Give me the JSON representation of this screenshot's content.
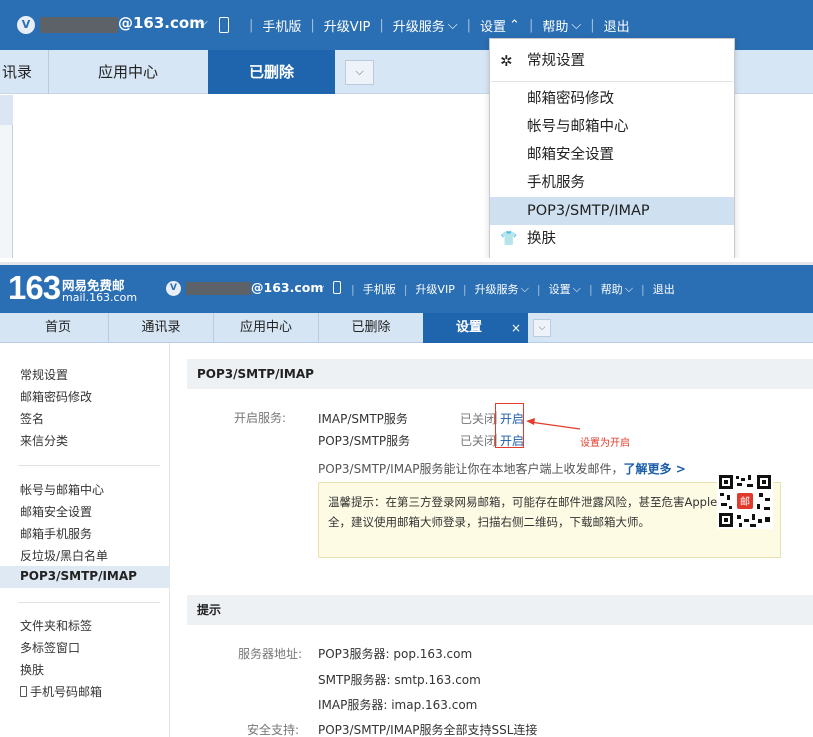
{
  "top": {
    "avatar": "V",
    "email_suffix": "@163.com",
    "nav": [
      "手机版",
      "升级VIP",
      "升级服务",
      "设置",
      "帮助",
      "退出"
    ],
    "tabs": [
      "讯录",
      "应用中心",
      "已删除"
    ],
    "dropdown": {
      "items": [
        {
          "label": "常规设置",
          "icon": "gear-icon"
        },
        {
          "label": "邮箱密码修改"
        },
        {
          "label": "帐号与邮箱中心"
        },
        {
          "label": "邮箱安全设置"
        },
        {
          "label": "手机服务"
        },
        {
          "label": "POP3/SMTP/IMAP",
          "highlighted": true
        },
        {
          "label": "换肤",
          "icon": "tshirt-icon"
        }
      ]
    }
  },
  "bottom": {
    "logo_number": "163",
    "logo_title": "网易免费邮",
    "logo_domain": "mail.163.com",
    "avatar": "V",
    "email_suffix": "@163.com",
    "nav": [
      "手机版",
      "升级VIP",
      "升级服务",
      "设置",
      "帮助",
      "退出"
    ],
    "tabs": [
      "首页",
      "通讯录",
      "应用中心",
      "已删除",
      "设置"
    ],
    "tab_close": "×",
    "sidebar": {
      "group1": [
        "常规设置",
        "邮箱密码修改",
        "签名",
        "来信分类"
      ],
      "group2": [
        "帐号与邮箱中心",
        "邮箱安全设置",
        "邮箱手机服务",
        "反垃圾/黑白名单",
        "POP3/SMTP/IMAP"
      ],
      "group3": [
        "文件夹和标签",
        "多标签窗口",
        "换肤",
        "手机号码邮箱"
      ]
    },
    "section1": {
      "title": "POP3/SMTP/IMAP",
      "open_label": "开启服务:",
      "services": [
        {
          "name": "IMAP/SMTP服务",
          "status": "已关闭",
          "action": "开启"
        },
        {
          "name": "POP3/SMTP服务",
          "status": "已关闭",
          "action": "开启"
        }
      ],
      "annotation": "设置为开启",
      "desc": "POP3/SMTP/IMAP服务能让你在本地客户端上收发邮件，",
      "learn_more": "了解更多 >",
      "tip_line1": "温馨提示：在第三方登录网易邮箱，可能存在邮件泄露风险，甚至危害Apple ID安",
      "tip_line2": "全，建议使用邮箱大师登录，扫描右侧二维码，下载邮箱大师。",
      "qr_badge": "邮"
    },
    "section2": {
      "title": "提示",
      "server_label": "服务器地址:",
      "servers": [
        "POP3服务器: pop.163.com",
        "SMTP服务器: smtp.163.com",
        "IMAP服务器: imap.163.com"
      ],
      "security_label": "安全支持:",
      "security_value": "POP3/SMTP/IMAP服务全部支持SSL连接"
    }
  }
}
